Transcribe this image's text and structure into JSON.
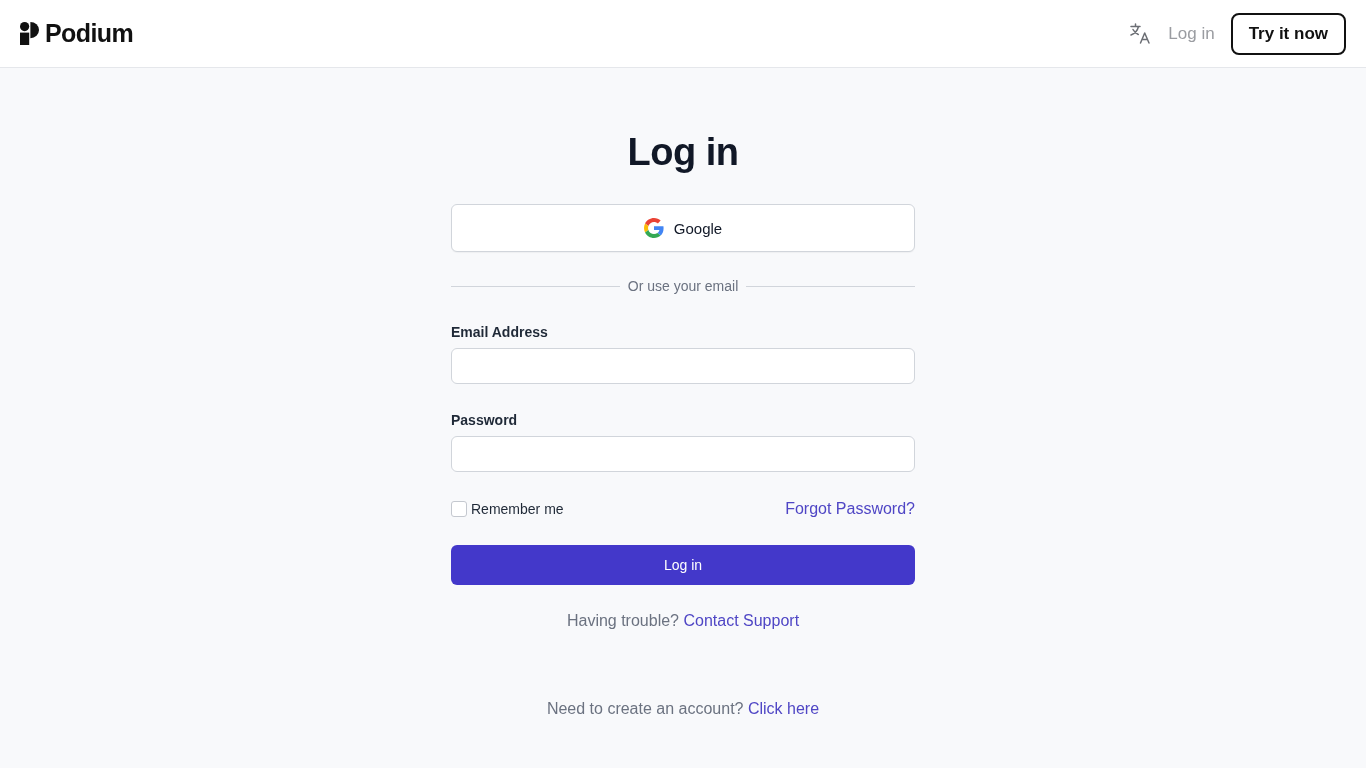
{
  "header": {
    "brand": "Podium",
    "nav_link": "Log in",
    "cta_button": "Try it now"
  },
  "login": {
    "title": "Log in",
    "google_button": "Google",
    "divider_text": "Or use your email",
    "fields": [
      {
        "label": "Email Address"
      },
      {
        "label": "Password"
      }
    ],
    "remember": {
      "label": "Remember me",
      "checked": false
    },
    "forgot_link": "Forgot Password?",
    "submit_button": "Log in",
    "help": {
      "text": "Having trouble?",
      "link": "Contact Support"
    },
    "signup": {
      "text": "Need to create an account?",
      "link": "Click here"
    }
  }
}
